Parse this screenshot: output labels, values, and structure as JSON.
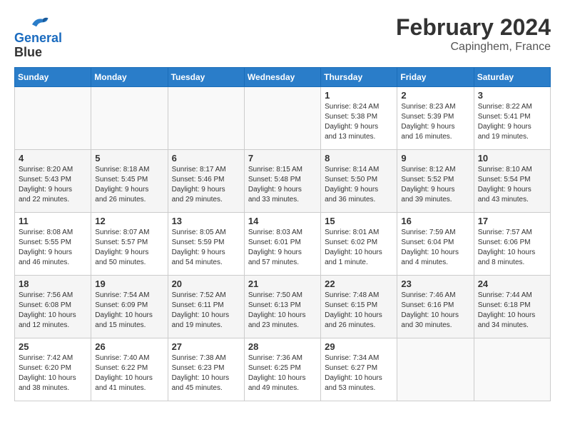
{
  "logo": {
    "line1": "General",
    "line2": "Blue"
  },
  "title": "February 2024",
  "subtitle": "Capinghem, France",
  "days_header": [
    "Sunday",
    "Monday",
    "Tuesday",
    "Wednesday",
    "Thursday",
    "Friday",
    "Saturday"
  ],
  "weeks": [
    [
      {
        "day": "",
        "info": ""
      },
      {
        "day": "",
        "info": ""
      },
      {
        "day": "",
        "info": ""
      },
      {
        "day": "",
        "info": ""
      },
      {
        "day": "1",
        "info": "Sunrise: 8:24 AM\nSunset: 5:38 PM\nDaylight: 9 hours\nand 13 minutes."
      },
      {
        "day": "2",
        "info": "Sunrise: 8:23 AM\nSunset: 5:39 PM\nDaylight: 9 hours\nand 16 minutes."
      },
      {
        "day": "3",
        "info": "Sunrise: 8:22 AM\nSunset: 5:41 PM\nDaylight: 9 hours\nand 19 minutes."
      }
    ],
    [
      {
        "day": "4",
        "info": "Sunrise: 8:20 AM\nSunset: 5:43 PM\nDaylight: 9 hours\nand 22 minutes."
      },
      {
        "day": "5",
        "info": "Sunrise: 8:18 AM\nSunset: 5:45 PM\nDaylight: 9 hours\nand 26 minutes."
      },
      {
        "day": "6",
        "info": "Sunrise: 8:17 AM\nSunset: 5:46 PM\nDaylight: 9 hours\nand 29 minutes."
      },
      {
        "day": "7",
        "info": "Sunrise: 8:15 AM\nSunset: 5:48 PM\nDaylight: 9 hours\nand 33 minutes."
      },
      {
        "day": "8",
        "info": "Sunrise: 8:14 AM\nSunset: 5:50 PM\nDaylight: 9 hours\nand 36 minutes."
      },
      {
        "day": "9",
        "info": "Sunrise: 8:12 AM\nSunset: 5:52 PM\nDaylight: 9 hours\nand 39 minutes."
      },
      {
        "day": "10",
        "info": "Sunrise: 8:10 AM\nSunset: 5:54 PM\nDaylight: 9 hours\nand 43 minutes."
      }
    ],
    [
      {
        "day": "11",
        "info": "Sunrise: 8:08 AM\nSunset: 5:55 PM\nDaylight: 9 hours\nand 46 minutes."
      },
      {
        "day": "12",
        "info": "Sunrise: 8:07 AM\nSunset: 5:57 PM\nDaylight: 9 hours\nand 50 minutes."
      },
      {
        "day": "13",
        "info": "Sunrise: 8:05 AM\nSunset: 5:59 PM\nDaylight: 9 hours\nand 54 minutes."
      },
      {
        "day": "14",
        "info": "Sunrise: 8:03 AM\nSunset: 6:01 PM\nDaylight: 9 hours\nand 57 minutes."
      },
      {
        "day": "15",
        "info": "Sunrise: 8:01 AM\nSunset: 6:02 PM\nDaylight: 10 hours\nand 1 minute."
      },
      {
        "day": "16",
        "info": "Sunrise: 7:59 AM\nSunset: 6:04 PM\nDaylight: 10 hours\nand 4 minutes."
      },
      {
        "day": "17",
        "info": "Sunrise: 7:57 AM\nSunset: 6:06 PM\nDaylight: 10 hours\nand 8 minutes."
      }
    ],
    [
      {
        "day": "18",
        "info": "Sunrise: 7:56 AM\nSunset: 6:08 PM\nDaylight: 10 hours\nand 12 minutes."
      },
      {
        "day": "19",
        "info": "Sunrise: 7:54 AM\nSunset: 6:09 PM\nDaylight: 10 hours\nand 15 minutes."
      },
      {
        "day": "20",
        "info": "Sunrise: 7:52 AM\nSunset: 6:11 PM\nDaylight: 10 hours\nand 19 minutes."
      },
      {
        "day": "21",
        "info": "Sunrise: 7:50 AM\nSunset: 6:13 PM\nDaylight: 10 hours\nand 23 minutes."
      },
      {
        "day": "22",
        "info": "Sunrise: 7:48 AM\nSunset: 6:15 PM\nDaylight: 10 hours\nand 26 minutes."
      },
      {
        "day": "23",
        "info": "Sunrise: 7:46 AM\nSunset: 6:16 PM\nDaylight: 10 hours\nand 30 minutes."
      },
      {
        "day": "24",
        "info": "Sunrise: 7:44 AM\nSunset: 6:18 PM\nDaylight: 10 hours\nand 34 minutes."
      }
    ],
    [
      {
        "day": "25",
        "info": "Sunrise: 7:42 AM\nSunset: 6:20 PM\nDaylight: 10 hours\nand 38 minutes."
      },
      {
        "day": "26",
        "info": "Sunrise: 7:40 AM\nSunset: 6:22 PM\nDaylight: 10 hours\nand 41 minutes."
      },
      {
        "day": "27",
        "info": "Sunrise: 7:38 AM\nSunset: 6:23 PM\nDaylight: 10 hours\nand 45 minutes."
      },
      {
        "day": "28",
        "info": "Sunrise: 7:36 AM\nSunset: 6:25 PM\nDaylight: 10 hours\nand 49 minutes."
      },
      {
        "day": "29",
        "info": "Sunrise: 7:34 AM\nSunset: 6:27 PM\nDaylight: 10 hours\nand 53 minutes."
      },
      {
        "day": "",
        "info": ""
      },
      {
        "day": "",
        "info": ""
      }
    ]
  ]
}
